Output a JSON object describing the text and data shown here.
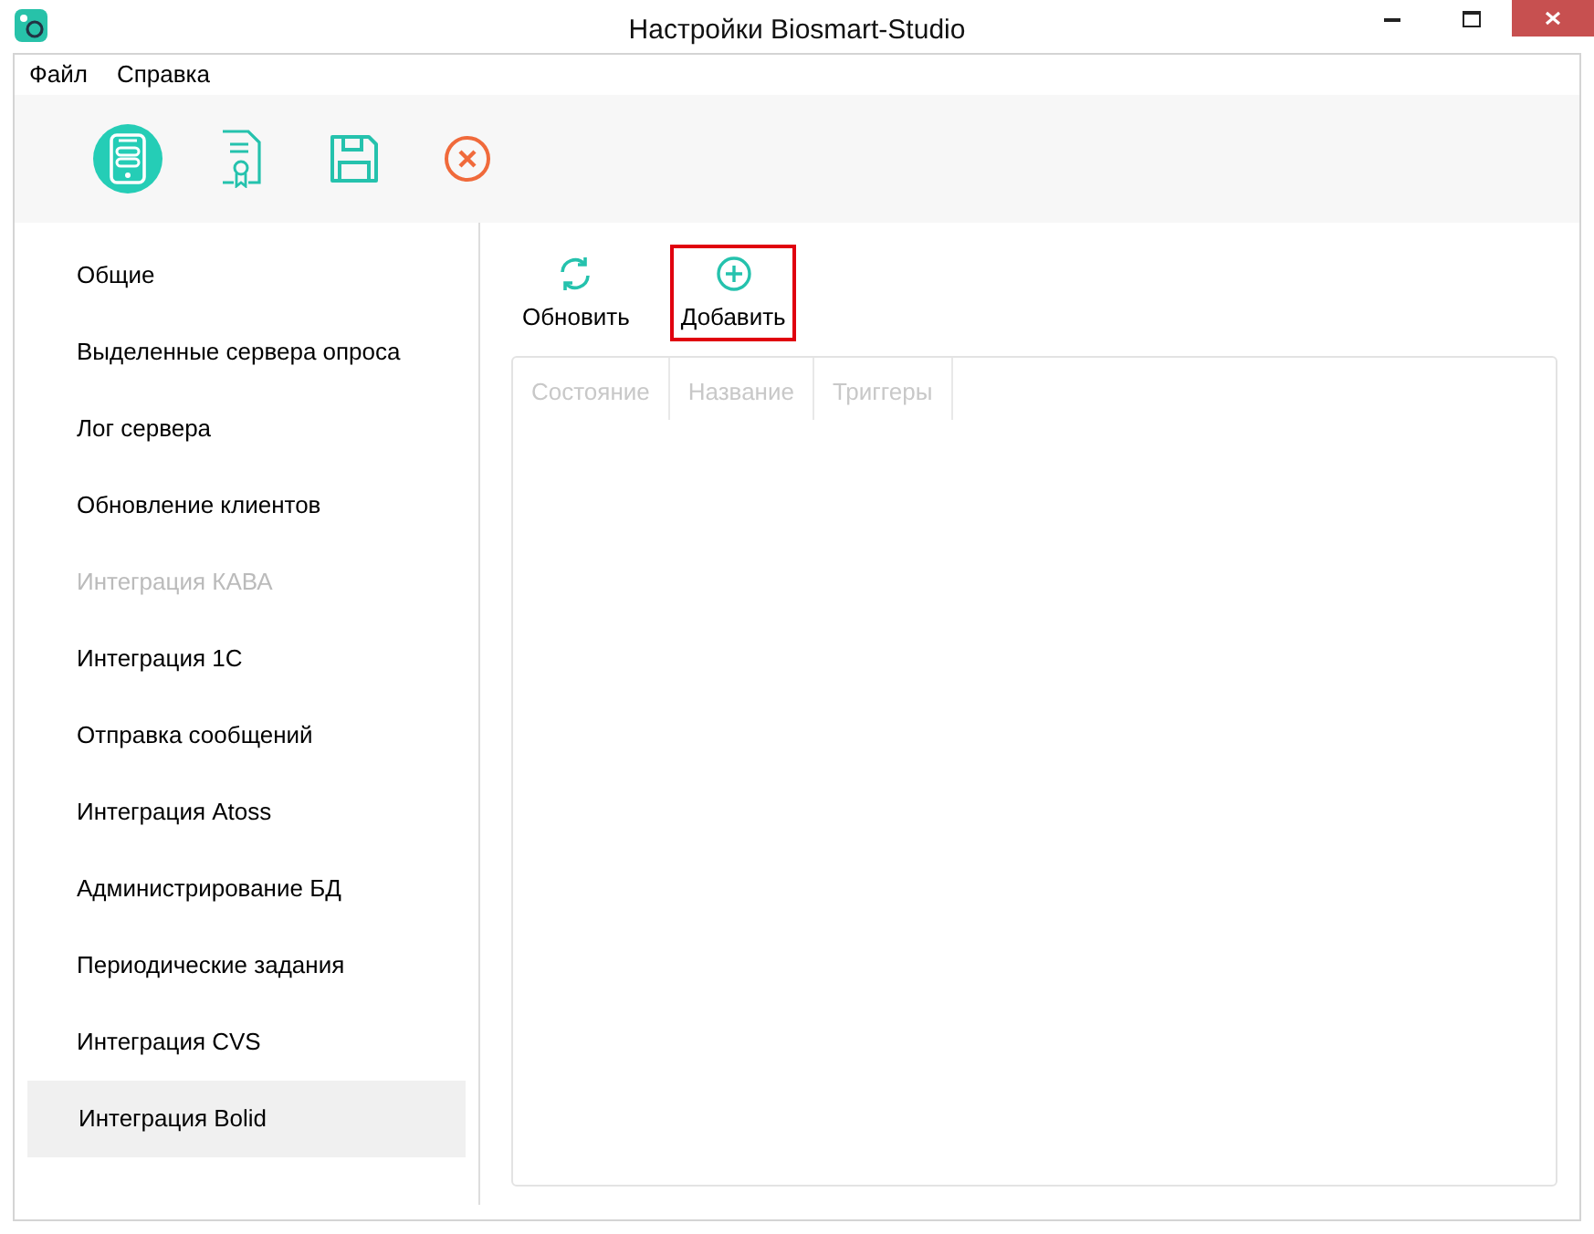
{
  "window": {
    "title": "Настройки Biosmart-Studio"
  },
  "menu": [
    "Файл",
    "Справка"
  ],
  "toolbar": [
    {
      "kind": "server",
      "selected": true
    },
    {
      "kind": "certificate",
      "selected": false
    },
    {
      "kind": "save",
      "selected": false
    },
    {
      "kind": "cancel",
      "selected": false
    }
  ],
  "sidebar": {
    "items": [
      {
        "label": "Общие",
        "selected": false,
        "disabled": false
      },
      {
        "label": "Выделенные сервера опроса",
        "selected": false,
        "disabled": false
      },
      {
        "label": "Лог сервера",
        "selected": false,
        "disabled": false
      },
      {
        "label": "Обновление клиентов",
        "selected": false,
        "disabled": false
      },
      {
        "label": "Интеграция КАВА",
        "selected": false,
        "disabled": true
      },
      {
        "label": "Интеграция 1С",
        "selected": false,
        "disabled": false
      },
      {
        "label": "Отправка сообщений",
        "selected": false,
        "disabled": false
      },
      {
        "label": "Интеграция Atoss",
        "selected": false,
        "disabled": false
      },
      {
        "label": "Администрирование БД",
        "selected": false,
        "disabled": false
      },
      {
        "label": "Периодические задания",
        "selected": false,
        "disabled": false
      },
      {
        "label": "Интеграция CVS",
        "selected": false,
        "disabled": false
      },
      {
        "label": "Интеграция Bolid",
        "selected": true,
        "disabled": false
      }
    ]
  },
  "actions": [
    {
      "kind": "refresh",
      "label": "Обновить",
      "highlighted": false
    },
    {
      "kind": "add",
      "label": "Добавить",
      "highlighted": true
    }
  ],
  "table": {
    "columns": [
      "Состояние",
      "Название",
      "Триггеры"
    ]
  }
}
